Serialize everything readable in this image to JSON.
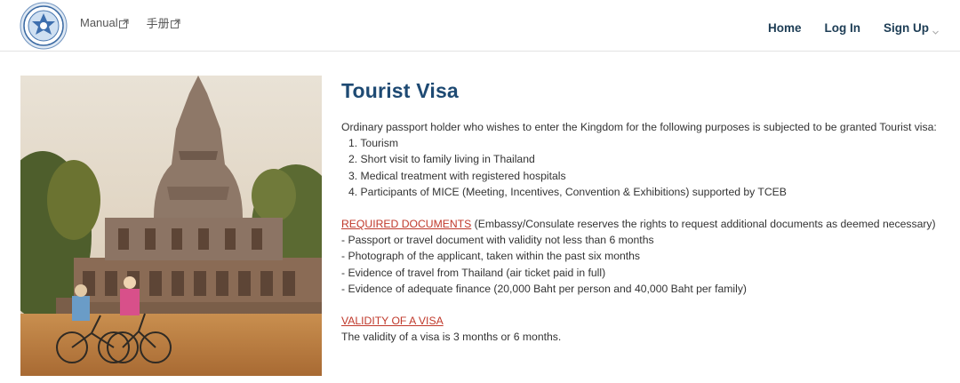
{
  "header": {
    "logo_icon": "thai-government-seal-icon",
    "left_links": [
      {
        "label": "Manual",
        "icon": "external-link-icon"
      },
      {
        "label": "手册",
        "icon": "external-link-icon"
      }
    ],
    "right_nav": {
      "home": "Home",
      "login": "Log In",
      "signup": "Sign Up",
      "signup_icon": "chevron-down-icon"
    }
  },
  "main": {
    "image_desc": "temple-with-cyclists-photo",
    "title": "Tourist Visa",
    "intro": "Ordinary passport holder who wishes to enter the Kingdom for the following purposes is subjected to be granted Tourist visa:",
    "purposes": [
      "1. Tourism",
      "2. Short visit to family living in Thailand",
      "3. Medical treatment with registered hospitals",
      "4. Participants of MICE (Meeting, Incentives, Convention & Exhibitions) supported by TCEB"
    ],
    "required_heading": "REQUIRED DOCUMENTS",
    "required_note": " (Embassy/Consulate reserves the rights to request additional documents as deemed necessary)",
    "required_items": [
      "- Passport or travel document with validity not less than 6 months",
      "- Photograph of the applicant, taken within the past six months",
      "- Evidence of travel from Thailand (air ticket paid in full)",
      "- Evidence of adequate finance (20,000 Baht per person and 40,000 Baht per family)"
    ],
    "validity_heading": "VALIDITY OF A VISA",
    "validity_text": "The validity of a visa is 3 months or 6 months."
  },
  "colors": {
    "title": "#1e4a73",
    "nav": "#1d3d55",
    "section_heading": "#c0392b"
  }
}
